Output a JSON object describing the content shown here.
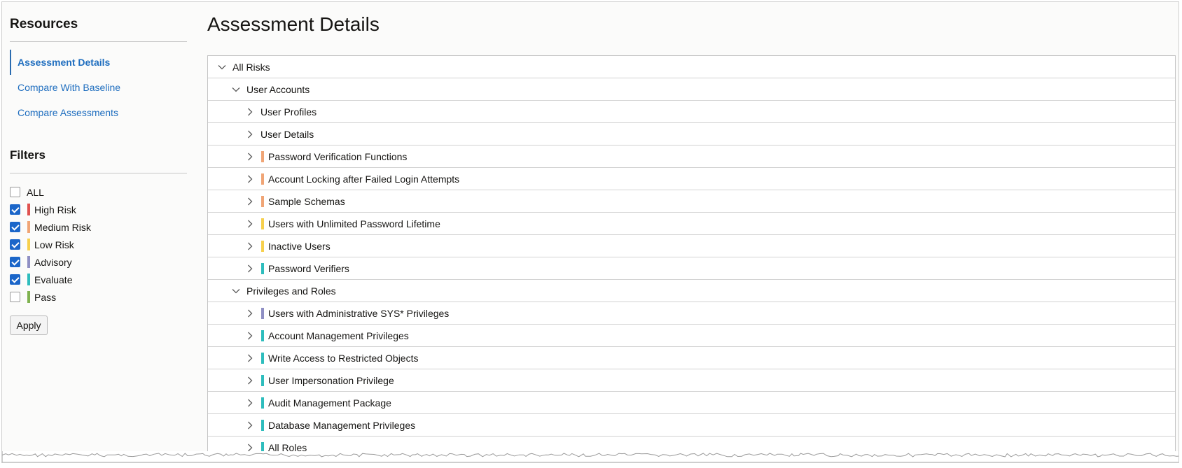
{
  "sidebar": {
    "resources_title": "Resources",
    "nav": [
      {
        "label": "Assessment Details",
        "active": true
      },
      {
        "label": "Compare With Baseline",
        "active": false
      },
      {
        "label": "Compare Assessments",
        "active": false
      }
    ],
    "filters_title": "Filters",
    "filters": [
      {
        "label": "ALL",
        "checked": false,
        "color": null
      },
      {
        "label": "High Risk",
        "checked": true,
        "color": "#e0524f"
      },
      {
        "label": "Medium Risk",
        "checked": true,
        "color": "#f0a576"
      },
      {
        "label": "Low Risk",
        "checked": true,
        "color": "#f7d04d"
      },
      {
        "label": "Advisory",
        "checked": true,
        "color": "#8f8fc4"
      },
      {
        "label": "Evaluate",
        "checked": true,
        "color": "#2ebdbd"
      },
      {
        "label": "Pass",
        "checked": false,
        "color": "#7fb24f"
      }
    ],
    "apply_label": "Apply"
  },
  "main": {
    "title": "Assessment Details",
    "tree": [
      {
        "label": "All Risks",
        "level": 0,
        "expanded": true,
        "color": null
      },
      {
        "label": "User Accounts",
        "level": 1,
        "expanded": true,
        "color": null
      },
      {
        "label": "User Profiles",
        "level": 2,
        "expanded": false,
        "color": null
      },
      {
        "label": "User Details",
        "level": 2,
        "expanded": false,
        "color": null
      },
      {
        "label": "Password Verification Functions",
        "level": 2,
        "expanded": false,
        "color": "#f0a576"
      },
      {
        "label": "Account Locking after Failed Login Attempts",
        "level": 2,
        "expanded": false,
        "color": "#f0a576"
      },
      {
        "label": "Sample Schemas",
        "level": 2,
        "expanded": false,
        "color": "#f0a576"
      },
      {
        "label": "Users with Unlimited Password Lifetime",
        "level": 2,
        "expanded": false,
        "color": "#f7d04d"
      },
      {
        "label": "Inactive Users",
        "level": 2,
        "expanded": false,
        "color": "#f7d04d"
      },
      {
        "label": "Password Verifiers",
        "level": 2,
        "expanded": false,
        "color": "#2ebdbd"
      },
      {
        "label": "Privileges and Roles",
        "level": 1,
        "expanded": true,
        "color": null
      },
      {
        "label": "Users with Administrative SYS* Privileges",
        "level": 2,
        "expanded": false,
        "color": "#8f8fc4"
      },
      {
        "label": "Account Management Privileges",
        "level": 2,
        "expanded": false,
        "color": "#2ebdbd"
      },
      {
        "label": "Write Access to Restricted Objects",
        "level": 2,
        "expanded": false,
        "color": "#2ebdbd"
      },
      {
        "label": "User Impersonation Privilege",
        "level": 2,
        "expanded": false,
        "color": "#2ebdbd"
      },
      {
        "label": "Audit Management Package",
        "level": 2,
        "expanded": false,
        "color": "#2ebdbd"
      },
      {
        "label": "Database Management Privileges",
        "level": 2,
        "expanded": false,
        "color": "#2ebdbd"
      },
      {
        "label": "All Roles",
        "level": 2,
        "expanded": false,
        "color": "#2ebdbd"
      }
    ]
  }
}
